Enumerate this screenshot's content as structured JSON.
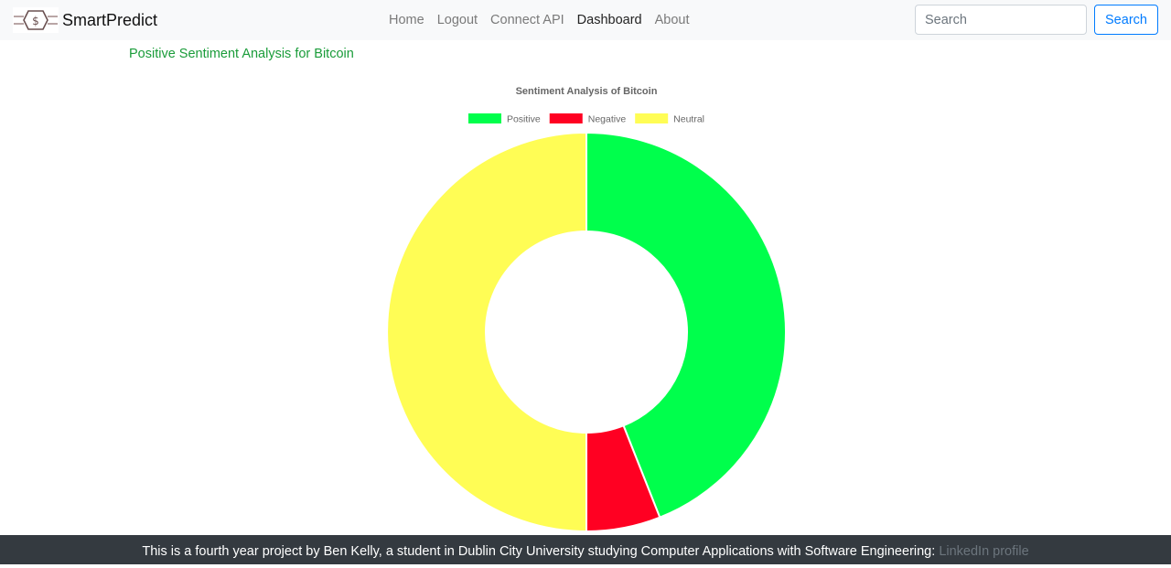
{
  "navbar": {
    "brand_name": "SmartPredict",
    "brand_logo_icon": "dollar-hex-logo-icon",
    "links": [
      {
        "label": "Home",
        "active": false
      },
      {
        "label": "Logout",
        "active": false
      },
      {
        "label": "Connect API",
        "active": false
      },
      {
        "label": "Dashboard",
        "active": true
      },
      {
        "label": "About",
        "active": false
      }
    ],
    "search_placeholder": "Search",
    "search_button_label": "Search"
  },
  "main": {
    "heading": "Positive Sentiment Analysis for Bitcoin"
  },
  "chart_data": {
    "type": "pie",
    "title": "Sentiment Analysis of Bitcoin",
    "categories": [
      "Positive",
      "Negative",
      "Neutral"
    ],
    "values": [
      44,
      6,
      50
    ],
    "colors": [
      "#00ff4c",
      "#ff0022",
      "#fffd55"
    ],
    "legend": "top",
    "cutout": "50%"
  },
  "footer": {
    "text": "This is a fourth year project by Ben Kelly, a student in Dublin City University studying Computer Applications with Software Engineering: ",
    "link_label": "LinkedIn profile"
  },
  "colors": {
    "navbar_bg": "#f8f9fa",
    "accent": "#007bff",
    "heading_green": "#1a9c3a",
    "footer_bg": "#343a40"
  }
}
